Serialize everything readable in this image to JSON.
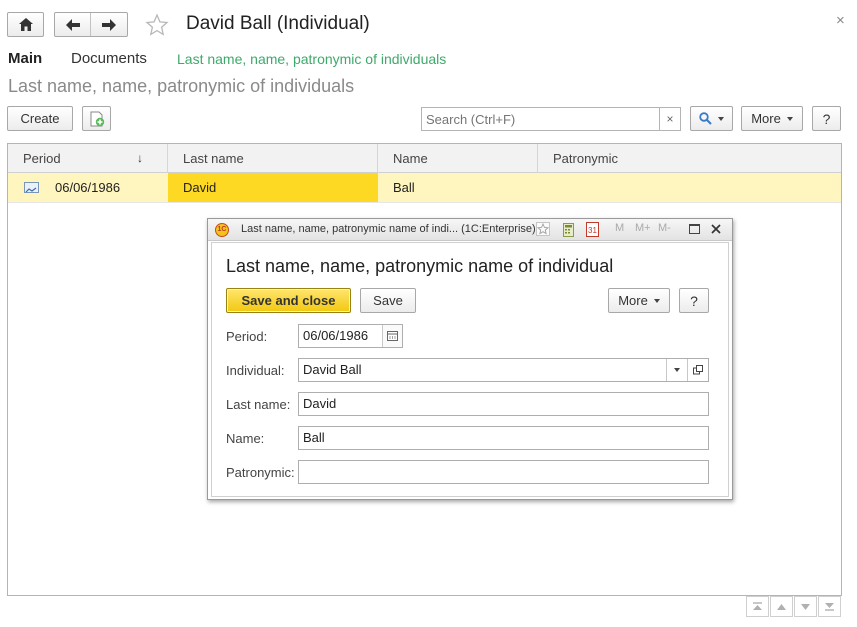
{
  "header": {
    "title": "David Ball (Individual)",
    "close_glyph": "×",
    "icons": [
      "home-icon",
      "back-arrow-icon",
      "forward-arrow-icon",
      "star-icon"
    ]
  },
  "tabs": [
    {
      "label": "Main"
    },
    {
      "label": "Documents"
    },
    {
      "label": "Last name, name, patronymic of individuals"
    }
  ],
  "list": {
    "title": "Last name, name, patronymic of individuals",
    "create_label": "Create",
    "search_placeholder": "Search (Ctrl+F)",
    "search_clear": "×",
    "more_label": "More",
    "help_label": "?",
    "columns": [
      "Period",
      "Last name",
      "Name",
      "Patronymic"
    ],
    "sort_glyph": "↓",
    "rows": [
      {
        "period": "06/06/1986",
        "last_name": "David",
        "name": "Ball",
        "patronymic": ""
      }
    ]
  },
  "dialog": {
    "window_title": "Last name, name, patronymic name of indi...  (1C:Enterprise)",
    "heading": "Last name, name, patronymic name of individual",
    "save_close_label": "Save and close",
    "save_label": "Save",
    "more_label": "More",
    "help_label": "?",
    "toolbar_marks": [
      "M",
      "M+",
      "M-"
    ],
    "fields": {
      "period": {
        "label": "Period:",
        "value": "06/06/1986"
      },
      "individual": {
        "label": "Individual:",
        "value": "David Ball"
      },
      "last_name": {
        "label": "Last name:",
        "value": "David"
      },
      "name": {
        "label": "Name:",
        "value": "Ball"
      },
      "patronymic": {
        "label": "Patronymic:",
        "value": ""
      }
    }
  },
  "colors": {
    "accent_green": "#3fa96b",
    "row_highlight": "#fff6bf",
    "current_cell": "#fed923",
    "primary_button": "#f5d327"
  }
}
